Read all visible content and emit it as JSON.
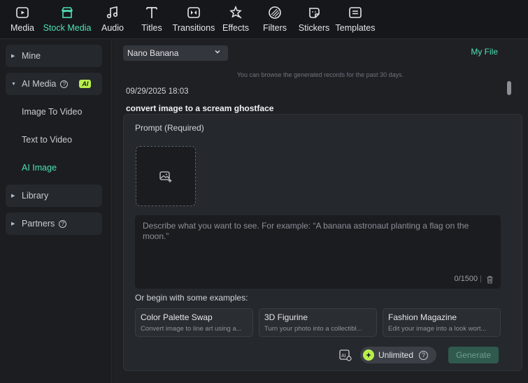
{
  "toolbar": {
    "tabs": [
      {
        "label": "Media",
        "icon": "media-icon"
      },
      {
        "label": "Stock Media",
        "icon": "stock-media-icon",
        "active": true
      },
      {
        "label": "Audio",
        "icon": "audio-icon"
      },
      {
        "label": "Titles",
        "icon": "titles-icon"
      },
      {
        "label": "Transitions",
        "icon": "transitions-icon"
      },
      {
        "label": "Effects",
        "icon": "effects-icon"
      },
      {
        "label": "Filters",
        "icon": "filters-icon"
      },
      {
        "label": "Stickers",
        "icon": "stickers-icon"
      },
      {
        "label": "Templates",
        "icon": "templates-icon"
      }
    ]
  },
  "sidebar": {
    "mine": "Mine",
    "ai_media": "AI Media",
    "ai_badge": "AI",
    "help_glyph": "?",
    "sub_items": [
      "Image To Video",
      "Text to Video",
      "AI Image"
    ],
    "library": "Library",
    "partners": "Partners"
  },
  "main": {
    "model_select": "Nano Banana",
    "my_file": "My File",
    "hint": "You can browse the generated records for the past 30 days.",
    "record_date": "09/29/2025 18:03",
    "record_title": "convert image to a scream ghostface",
    "prompt_label": "Prompt (Required)",
    "prompt_placeholder": "Describe what you want to see. For example: “A banana astronaut planting a flag on the moon.”",
    "counter": "0/1500",
    "examples_label": "Or begin with some examples:",
    "examples": [
      {
        "title": "Color Palette Swap",
        "desc": "Convert image to line art using a..."
      },
      {
        "title": "3D Figurine",
        "desc": "Turn your photo into a collectibl..."
      },
      {
        "title": "Fashion Magazine",
        "desc": "Edit your image into a look wort..."
      }
    ],
    "unlimited": "Unlimited",
    "generate": "Generate"
  },
  "colors": {
    "accent": "#4fe0b5",
    "badge": "#b8f04a",
    "background": "#1e2024"
  }
}
